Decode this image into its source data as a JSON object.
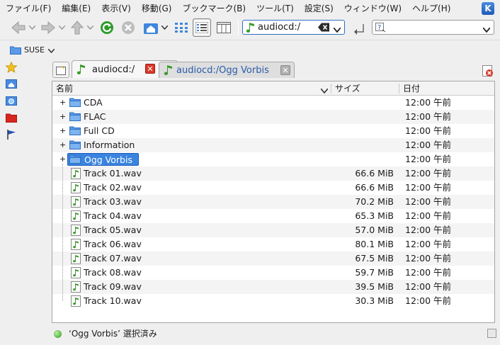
{
  "menubar": {
    "items": [
      "ファイル(F)",
      "編集(E)",
      "表示(V)",
      "移動(G)",
      "ブックマーク(B)",
      "ツール(T)",
      "設定(S)",
      "ウィンドウ(W)",
      "ヘルプ(H)"
    ],
    "logo": "K"
  },
  "toolbar": {
    "location_value": "audiocd:/",
    "search_placeholder": ""
  },
  "bookmarkbar": {
    "folder_label": "SUSE"
  },
  "tabs": [
    {
      "label": "audiocd:/",
      "active": true
    },
    {
      "label": "audiocd:/Ogg Vorbis",
      "active": false
    }
  ],
  "columns": {
    "name": "名前",
    "size": "サイズ",
    "date": "日付"
  },
  "rows": [
    {
      "name": "CDA",
      "type": "folder",
      "size": "",
      "date": "12:00 午前",
      "selected": false
    },
    {
      "name": "FLAC",
      "type": "folder",
      "size": "",
      "date": "12:00 午前",
      "selected": false
    },
    {
      "name": "Full CD",
      "type": "folder",
      "size": "",
      "date": "12:00 午前",
      "selected": false
    },
    {
      "name": "Information",
      "type": "folder",
      "size": "",
      "date": "12:00 午前",
      "selected": false
    },
    {
      "name": "Ogg Vorbis",
      "type": "folder",
      "size": "",
      "date": "12:00 午前",
      "selected": true
    },
    {
      "name": "Track 01.wav",
      "type": "audio",
      "size": "66.6 MiB",
      "date": "12:00 午前",
      "selected": false
    },
    {
      "name": "Track 02.wav",
      "type": "audio",
      "size": "66.6 MiB",
      "date": "12:00 午前",
      "selected": false
    },
    {
      "name": "Track 03.wav",
      "type": "audio",
      "size": "70.2 MiB",
      "date": "12:00 午前",
      "selected": false
    },
    {
      "name": "Track 04.wav",
      "type": "audio",
      "size": "65.3 MiB",
      "date": "12:00 午前",
      "selected": false
    },
    {
      "name": "Track 05.wav",
      "type": "audio",
      "size": "57.0 MiB",
      "date": "12:00 午前",
      "selected": false
    },
    {
      "name": "Track 06.wav",
      "type": "audio",
      "size": "80.1 MiB",
      "date": "12:00 午前",
      "selected": false
    },
    {
      "name": "Track 07.wav",
      "type": "audio",
      "size": "67.5 MiB",
      "date": "12:00 午前",
      "selected": false
    },
    {
      "name": "Track 08.wav",
      "type": "audio",
      "size": "59.7 MiB",
      "date": "12:00 午前",
      "selected": false
    },
    {
      "name": "Track 09.wav",
      "type": "audio",
      "size": "39.5 MiB",
      "date": "12:00 午前",
      "selected": false
    },
    {
      "name": "Track 10.wav",
      "type": "audio",
      "size": "30.3 MiB",
      "date": "12:00 午前",
      "selected": false
    }
  ],
  "statusbar": {
    "text": "‘Ogg Vorbis’ 選択済み"
  },
  "colors": {
    "selection": "#3a84e0",
    "folder": "#5a9be8",
    "close_red": "#d93a2b",
    "tab_text_inactive": "#2a5caa"
  }
}
